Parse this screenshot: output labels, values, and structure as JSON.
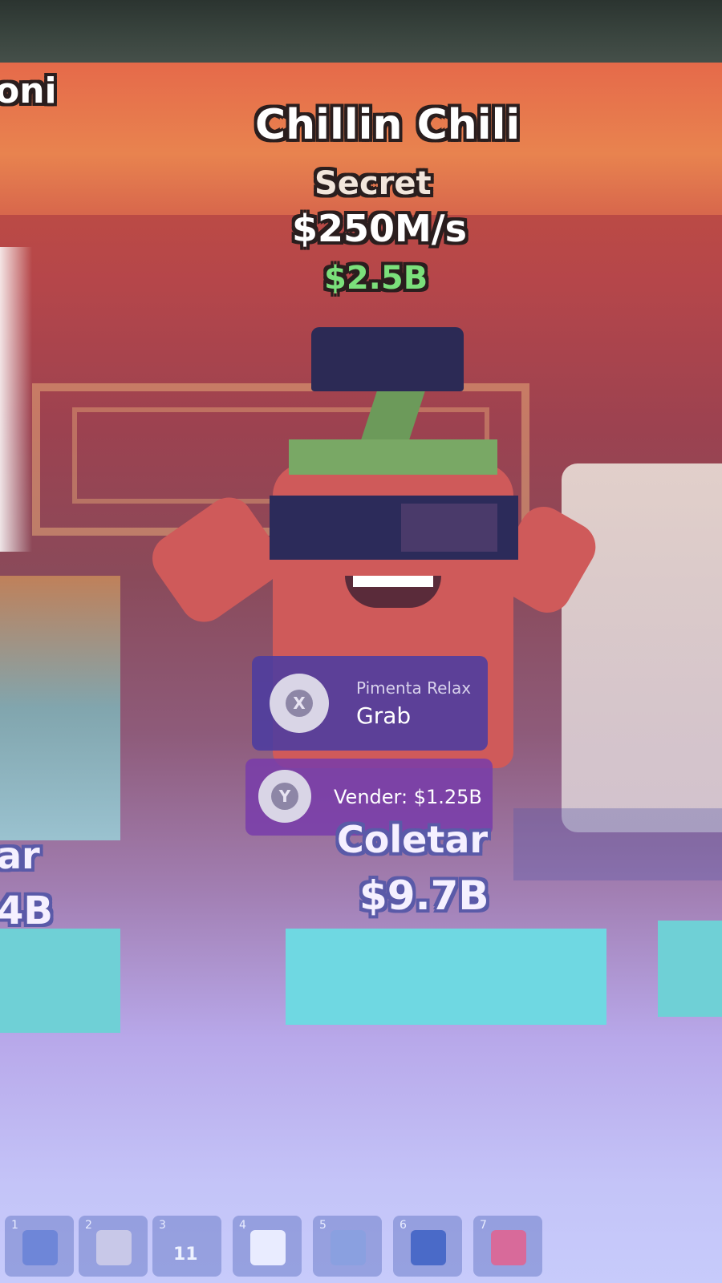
{
  "overhead": {
    "left_name_fragment": "oni",
    "pet_name": "Chillin Chili",
    "rarity": "Secret",
    "rate": "$250M/s",
    "price": "$2.5B"
  },
  "prompt": {
    "grab_key": "X",
    "subtitle": "Pimenta Relax",
    "action": "Grab",
    "sell_key": "Y",
    "sell_label": "Vender: $1.25B"
  },
  "collect": {
    "label": "Coletar",
    "amount": "$9.7B",
    "left_label_fragment": "ar",
    "left_amount_fragment": "4B"
  },
  "hotbar": {
    "slots": [
      {
        "number": "1",
        "icon": "tool-icon",
        "count": ""
      },
      {
        "number": "2",
        "icon": "claw-icon",
        "count": ""
      },
      {
        "number": "3",
        "icon": "item-icon",
        "count": "11"
      },
      {
        "number": "4",
        "icon": "item-icon",
        "count": ""
      },
      {
        "number": "5",
        "icon": "item-icon",
        "count": ""
      },
      {
        "number": "6",
        "icon": "item-icon",
        "count": ""
      },
      {
        "number": "7",
        "icon": "magnet-icon",
        "count": ""
      }
    ]
  },
  "colors": {
    "price_green": "#7be07b",
    "prompt_bg": "#4c3ca0",
    "collect_pad": "#6fd8e2"
  }
}
